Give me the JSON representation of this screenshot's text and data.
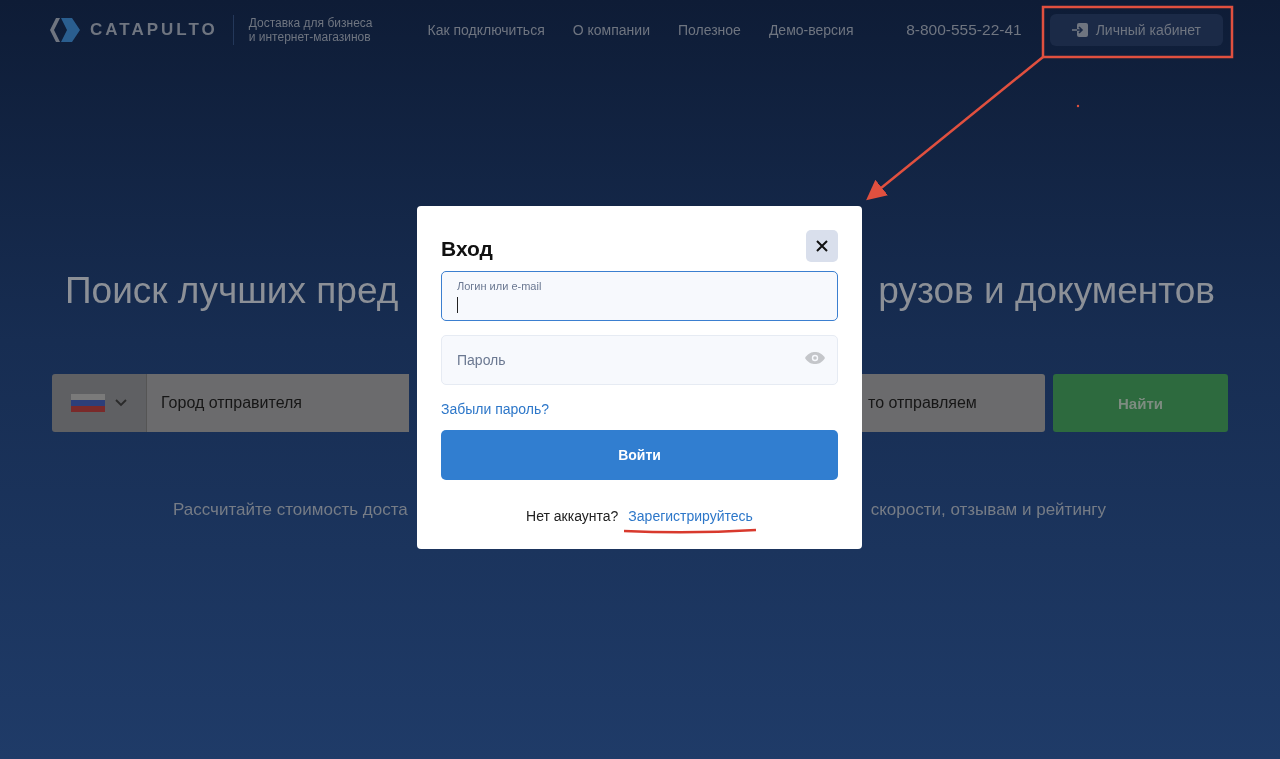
{
  "header": {
    "logo": "CATAPULTO",
    "tagline": [
      "Доставка для бизнеса",
      "и интернет-магазинов"
    ],
    "nav": [
      "Как подключиться",
      "О компании",
      "Полезное",
      "Демо-версия"
    ],
    "phone": "8-800-555-22-41",
    "account_button": "Личный кабинет"
  },
  "hero": {
    "title_left": "Поиск лучших пред",
    "title_right": "рузов и документов",
    "subtitle_left": "Рассчитайте стоимость доста",
    "subtitle_right": "скорости, отзывам и рейтингу"
  },
  "search": {
    "sender_city_placeholder": "Город отправителя",
    "cargo_placeholder": "то отправляем",
    "submit": "Найти"
  },
  "login_modal": {
    "title": "Вход",
    "fields": [
      {
        "kind": "text",
        "label": "Логин или e-mail",
        "focused": true
      },
      {
        "kind": "password",
        "label": "Пароль",
        "focused": false
      }
    ],
    "forgot_link": "Забыли пароль?",
    "submit": "Войти",
    "no_account": "Нет аккаунта?",
    "register_link": "Зарегистрируйтесь"
  }
}
